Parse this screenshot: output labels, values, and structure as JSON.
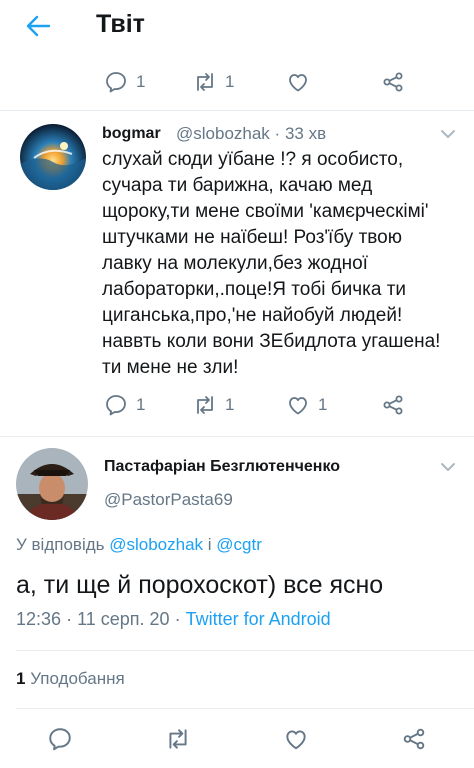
{
  "header": {
    "title": "Твіт"
  },
  "top_actions": {
    "reply_count": "1",
    "retweet_count": "1"
  },
  "reply_tweet": {
    "name": "bogmar",
    "handle": "@slobozhak",
    "separator": "·",
    "time": "33 хв",
    "text_lines": [
      "слухай сюди уїбане !? я особисто,",
      "сучара ти барижна, качаю мед",
      "щороку,ти мене своїми 'камєрческімі'",
      "штучками не наїбеш! Роз'їбу твою",
      "лавку на молекули,без жодної",
      "лабораторки,.поце!Я тобі бичка ти",
      "циганська,про,'не найобуй людей!",
      "наввть коли вони ЗЕбидлота угашена!",
      "ти мене не зли!"
    ],
    "reply_count": "1",
    "retweet_count": "1",
    "like_count": "1"
  },
  "main_tweet": {
    "name": "Пастафаріан Безглютенченко",
    "handle": "@PastorPasta69",
    "reply_prefix": "У відповідь",
    "reply_to_1": "@slobozhak",
    "reply_conj": "і",
    "reply_to_2": "@cgtr",
    "text": "а, ти ще й порохоскот) все ясно",
    "time": "12:36",
    "separator": "·",
    "date": "11 серп. 20",
    "source": "Twitter for Android",
    "likes_count": "1",
    "likes_label": "Уподобання"
  },
  "colors": {
    "accent": "#1da1f2",
    "secondary": "#657786",
    "text": "#14171a",
    "divider": "#e6ecf0"
  },
  "icons": [
    "back-arrow-icon",
    "reply-icon",
    "retweet-icon",
    "like-icon",
    "share-icon",
    "chevron-down-icon"
  ]
}
